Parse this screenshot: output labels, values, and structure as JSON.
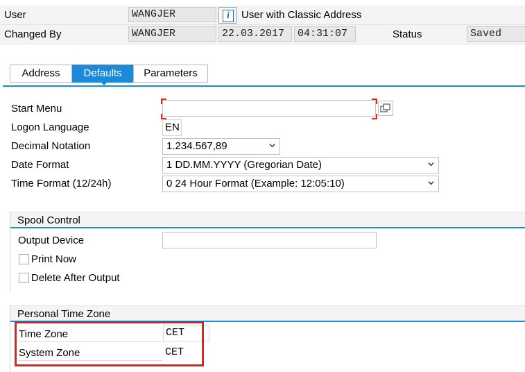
{
  "header": {
    "user_label": "User",
    "user_value": "WANGJER",
    "info_icon_glyph": "i",
    "user_description": "User with Classic Address",
    "changed_by_label": "Changed By",
    "changed_by_value": "WANGJER",
    "changed_date": "22.03.2017",
    "changed_time": "04:31:07",
    "status_label": "Status",
    "status_value": "Saved"
  },
  "tabs": [
    {
      "label": "Address",
      "active": false
    },
    {
      "label": "Defaults",
      "active": true
    },
    {
      "label": "Parameters",
      "active": false
    }
  ],
  "defaults": {
    "start_menu_label": "Start Menu",
    "start_menu_value": "",
    "logon_language_label": "Logon Language",
    "logon_language_value": "EN",
    "decimal_notation_label": "Decimal Notation",
    "decimal_notation_value": "1.234.567,89",
    "date_format_label": "Date Format",
    "date_format_value": "1 DD.MM.YYYY (Gregorian Date)",
    "time_format_label": "Time Format (12/24h)",
    "time_format_value": "0 24 Hour Format (Example: 12:05:10)"
  },
  "spool": {
    "title": "Spool Control",
    "output_device_label": "Output Device",
    "output_device_value": "",
    "print_now_label": "Print Now",
    "print_now_checked": false,
    "delete_after_output_label": "Delete After Output",
    "delete_after_output_checked": false
  },
  "time_zone": {
    "title": "Personal Time Zone",
    "time_zone_label": "Time Zone",
    "time_zone_value": "CET",
    "system_zone_label": "System Zone",
    "system_zone_value": "CET"
  },
  "colors": {
    "accent": "#1b8ad9",
    "highlight_box": "#e0201b",
    "required_marker": "#e0201b"
  },
  "icons": {
    "info": "info-icon",
    "value_help": "value-help-icon",
    "dropdown": "chevron-down-icon"
  }
}
